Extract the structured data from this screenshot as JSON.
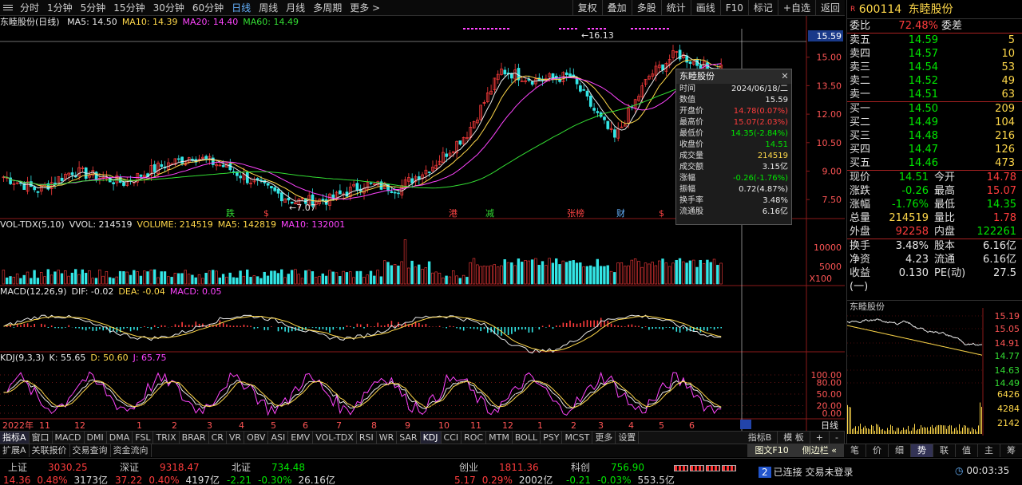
{
  "toolbar": {
    "periods": [
      "分时",
      "1分钟",
      "5分钟",
      "15分钟",
      "30分钟",
      "60分钟",
      "日线",
      "周线",
      "月线",
      "多周期",
      "更多 >"
    ],
    "active_period": "日线",
    "right_buttons": [
      "复权",
      "叠加",
      "多股",
      "统计",
      "画线",
      "F10",
      "标记",
      "+自选",
      "返回"
    ]
  },
  "chart": {
    "title": "东睦股份(日线)",
    "ma": [
      {
        "label": "MA5: 14.50",
        "color": "#e8e8e8"
      },
      {
        "label": "MA10: 14.39",
        "color": "#ffd84a"
      },
      {
        "label": "MA20: 14.40",
        "color": "#ff44ff"
      },
      {
        "label": "MA60: 14.49",
        "color": "#33dd33"
      }
    ],
    "price_axis": [
      "15.00",
      "13.50",
      "12.00",
      "10.50",
      "9.00",
      "7.50"
    ],
    "cursor_price": "15.59",
    "high_label": "16.13",
    "low_label": "7.07",
    "event_marks": [
      {
        "text": "跌",
        "color": "#33dd33"
      },
      {
        "text": "$",
        "color": "#ff4444"
      },
      {
        "text": "港",
        "color": "#ff4444"
      },
      {
        "text": "减",
        "color": "#33dd33"
      },
      {
        "text": "张榜",
        "color": "#ff4444"
      },
      {
        "text": "财",
        "color": "#66b3ff"
      },
      {
        "text": "$",
        "color": "#ff4444"
      }
    ],
    "vol_legend": [
      {
        "label": "VOL-TDX(5,10)",
        "color": "#e8e8e8"
      },
      {
        "label": "VVOL: 214519",
        "color": "#e8e8e8"
      },
      {
        "label": "VOLUME: 214519",
        "color": "#ffd84a"
      },
      {
        "label": "MA5: 142819",
        "color": "#ffd84a"
      },
      {
        "label": "MA10: 132001",
        "color": "#ff44ff"
      }
    ],
    "vol_axis": [
      "10000",
      "5000"
    ],
    "vol_unit": "X100",
    "macd_legend": [
      {
        "label": "MACD(12,26,9)",
        "color": "#e8e8e8"
      },
      {
        "label": "DIF: -0.02",
        "color": "#e8e8e8"
      },
      {
        "label": "DEA: -0.04",
        "color": "#ffd84a"
      },
      {
        "label": "MACD: 0.05",
        "color": "#ff44ff"
      }
    ],
    "kdj_legend": [
      {
        "label": "KDJ(9,3,3)",
        "color": "#e8e8e8"
      },
      {
        "label": "K: 55.65",
        "color": "#e8e8e8"
      },
      {
        "label": "D: 50.60",
        "color": "#ffd84a"
      },
      {
        "label": "J: 65.75",
        "color": "#ff44ff"
      }
    ],
    "kdj_axis": [
      "100.00",
      "80.00",
      "50.00",
      "20.00",
      "0.00"
    ],
    "x_labels": [
      "2022年",
      "11",
      "12",
      "1",
      "2",
      "3",
      "4",
      "5",
      "6",
      "7",
      "8",
      "9",
      "10",
      "11",
      "12",
      "1",
      "2",
      "3",
      "4",
      "5",
      "6"
    ],
    "period_label": "日线"
  },
  "tooltip": {
    "title": "东睦股份",
    "rows": [
      {
        "k": "时间",
        "v": "2024/06/18/二",
        "c": "white"
      },
      {
        "k": "数值",
        "v": "15.59",
        "c": "white"
      },
      {
        "k": "开盘价",
        "v": "14.78(0.07%)",
        "c": "red"
      },
      {
        "k": "最高价",
        "v": "15.07(2.03%)",
        "c": "red"
      },
      {
        "k": "最低价",
        "v": "14.35(-2.84%)",
        "c": "green"
      },
      {
        "k": "收盘价",
        "v": "14.51",
        "c": "green"
      },
      {
        "k": "成交量",
        "v": "214519",
        "c": "yellow"
      },
      {
        "k": "成交额",
        "v": "3.15亿",
        "c": "white"
      },
      {
        "k": "涨幅",
        "v": "-0.26(-1.76%)",
        "c": "green"
      },
      {
        "k": "振幅",
        "v": "0.72(4.87%)",
        "c": "white"
      },
      {
        "k": "换手率",
        "v": "3.48%",
        "c": "white"
      },
      {
        "k": "流通股",
        "v": "6.16亿",
        "c": "white"
      }
    ]
  },
  "quote": {
    "code": "600114",
    "name": "东睦股份",
    "weibi_label": "委比",
    "weibi": "72.48%",
    "weicha_label": "委差",
    "sell": [
      {
        "label": "卖五",
        "price": "14.59",
        "vol": "5"
      },
      {
        "label": "卖四",
        "price": "14.57",
        "vol": "10"
      },
      {
        "label": "卖三",
        "price": "14.54",
        "vol": "53"
      },
      {
        "label": "卖二",
        "price": "14.52",
        "vol": "49"
      },
      {
        "label": "卖一",
        "price": "14.51",
        "vol": "63"
      }
    ],
    "buy": [
      {
        "label": "买一",
        "price": "14.50",
        "vol": "209"
      },
      {
        "label": "买二",
        "price": "14.49",
        "vol": "104"
      },
      {
        "label": "买三",
        "price": "14.48",
        "vol": "216"
      },
      {
        "label": "买四",
        "price": "14.47",
        "vol": "126"
      },
      {
        "label": "买五",
        "price": "14.46",
        "vol": "473"
      }
    ],
    "stats": [
      {
        "l1": "现价",
        "v1": "14.51",
        "c1": "green",
        "l2": "今开",
        "v2": "14.78",
        "c2": "red"
      },
      {
        "l1": "涨跌",
        "v1": "-0.26",
        "c1": "green",
        "l2": "最高",
        "v2": "15.07",
        "c2": "red"
      },
      {
        "l1": "涨幅",
        "v1": "-1.76%",
        "c1": "green",
        "l2": "最低",
        "v2": "14.35",
        "c2": "green"
      },
      {
        "l1": "总量",
        "v1": "214519",
        "c1": "yellow",
        "l2": "量比",
        "v2": "1.78",
        "c2": "red"
      },
      {
        "l1": "外盘",
        "v1": "92258",
        "c1": "red",
        "l2": "内盘",
        "v2": "122261",
        "c2": "green"
      }
    ],
    "stats2": [
      {
        "l1": "换手",
        "v1": "3.48%",
        "c1": "white",
        "l2": "股本",
        "v2": "6.16亿",
        "c2": "white"
      },
      {
        "l1": "净资",
        "v1": "4.23",
        "c1": "white",
        "l2": "流通",
        "v2": "6.16亿",
        "c2": "white"
      },
      {
        "l1": "收益(一)",
        "v1": "0.130",
        "c1": "white",
        "l2": "PE(动)",
        "v2": "27.5",
        "c2": "white"
      }
    ],
    "mini_title": "东睦股份",
    "mini_axis": [
      "15.19",
      "15.05",
      "14.91",
      "14.77",
      "14.63",
      "14.49"
    ],
    "mini_vol_axis": [
      "6426",
      "4284",
      "2142"
    ]
  },
  "indicators": {
    "left_label": "指标A",
    "items": [
      "窗口",
      "MACD",
      "DMI",
      "DMA",
      "FSL",
      "TRIX",
      "BRAR",
      "CR",
      "VR",
      "OBV",
      "ASI",
      "EMV",
      "VOL-TDX",
      "RSI",
      "WR",
      "SAR",
      "KDJ",
      "CCI",
      "ROC",
      "MTM",
      "BOLL",
      "PSY",
      "MCST",
      "更多",
      "设置"
    ],
    "active": "KDJ",
    "right_items": [
      "指标B",
      "模 板",
      "+",
      "-"
    ]
  },
  "ext_bar": {
    "items": [
      "扩展A",
      "关联报价",
      "交易查询",
      "资金流向"
    ],
    "right_items": [
      "图文F10",
      "侧边栏 «",
      "笔",
      "价",
      "细",
      "势",
      "联",
      "值",
      "主",
      "筹"
    ],
    "active_right": "势"
  },
  "status": {
    "indices": [
      {
        "name": "上证",
        "value": "3030.25",
        "chg": "14.36",
        "pct": "0.48%",
        "amt": "3173亿",
        "dir": "red"
      },
      {
        "name": "深证",
        "value": "9318.47",
        "chg": "37.22",
        "pct": "0.40%",
        "amt": "4197亿",
        "dir": "red"
      },
      {
        "name": "北证",
        "value": "734.48",
        "chg": "-2.21",
        "pct": "-0.30%",
        "amt": "26.16亿",
        "dir": "green"
      },
      {
        "name": "创业",
        "value": "1811.36",
        "chg": "5.17",
        "pct": "0.29%",
        "amt": "2002亿",
        "dir": "red"
      },
      {
        "name": "科创",
        "value": "756.90",
        "chg": "-0.21",
        "pct": "-0.03%",
        "amt": "553.5亿",
        "dir": "green"
      }
    ],
    "connection": "已连接 交易未登录",
    "conn_num": "2",
    "time": "00:03:35"
  }
}
